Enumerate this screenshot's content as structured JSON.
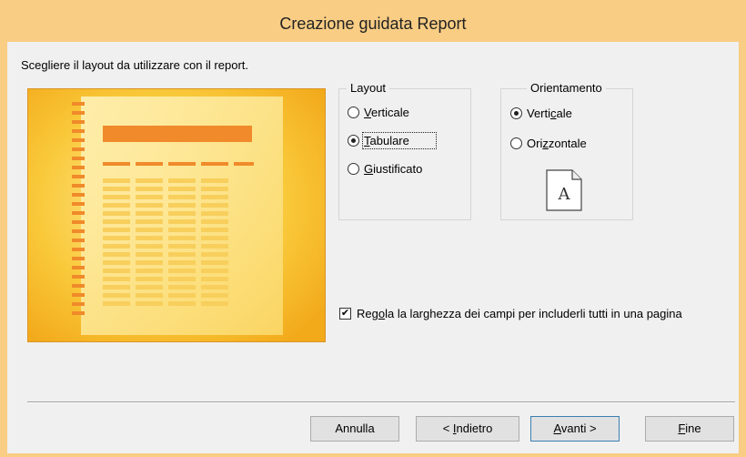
{
  "window": {
    "title": "Creazione guidata Report"
  },
  "instruction": "Scegliere il layout da utilizzare con il report.",
  "layout_group": {
    "legend": "Layout",
    "options": [
      {
        "pre": "",
        "key": "V",
        "post": "erticale",
        "selected": false
      },
      {
        "pre": "",
        "key": "T",
        "post": "abulare",
        "selected": true
      },
      {
        "pre": "",
        "key": "G",
        "post": "iustificato",
        "selected": false
      }
    ]
  },
  "orientation_group": {
    "legend": "Orientamento",
    "options": [
      {
        "pre": "Verti",
        "key": "c",
        "post": "ale",
        "selected": true
      },
      {
        "pre": "Ori",
        "key": "z",
        "post": "zontale",
        "selected": false
      }
    ],
    "icon_letter": "A"
  },
  "fit_checkbox": {
    "pre": "Reg",
    "key": "o",
    "post": "la la larghezza dei campi per includerli tutti in una pagina",
    "checked": true
  },
  "buttons": {
    "cancel": "Annulla",
    "back_pre": "< ",
    "back_key": "I",
    "back_post": "ndietro",
    "next_key": "A",
    "next_post": "vanti >",
    "finish_key": "F",
    "finish_post": "ine"
  },
  "colors": {
    "frame": "#f9cd84",
    "preview_orange": "#f3b81f",
    "preview_page": "#fde79a",
    "bar_orange": "#f08a2a"
  },
  "icons": {
    "preview": "tabular-report-preview",
    "page": "portrait-page-icon",
    "checkmark": "checkmark-icon"
  }
}
